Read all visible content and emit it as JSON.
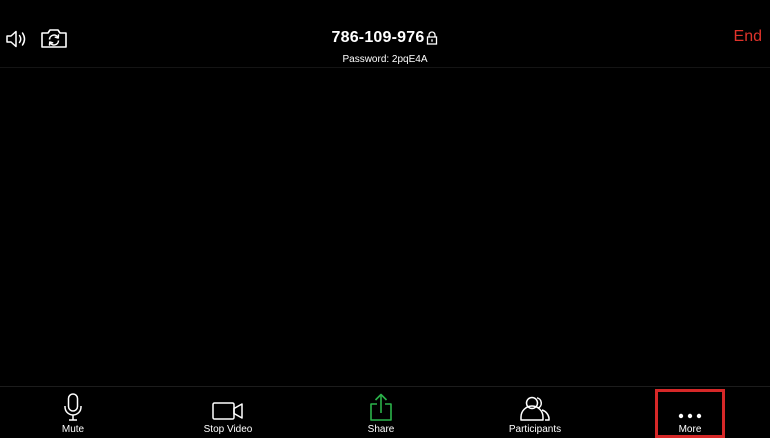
{
  "meeting": {
    "id": "786-109-976",
    "password": "Password: 2pqE4A",
    "end_label": "End"
  },
  "header": {
    "speaker_icon": "speaker-icon",
    "camera_switch_icon": "camera-switch-icon",
    "lock_icon": "lock-icon"
  },
  "toolbar": {
    "items": [
      {
        "label": "Mute",
        "icon": "microphone-icon"
      },
      {
        "label": "Stop Video",
        "icon": "video-camera-icon"
      },
      {
        "label": "Share",
        "icon": "share-icon"
      },
      {
        "label": "Participants",
        "icon": "participants-icon"
      },
      {
        "label": "More",
        "icon": "more-icon"
      }
    ]
  },
  "colors": {
    "background": "#000000",
    "end_text": "#e0332b",
    "share_icon": "#2bb34a",
    "highlight_border": "#d62828",
    "text": "#ffffff"
  }
}
